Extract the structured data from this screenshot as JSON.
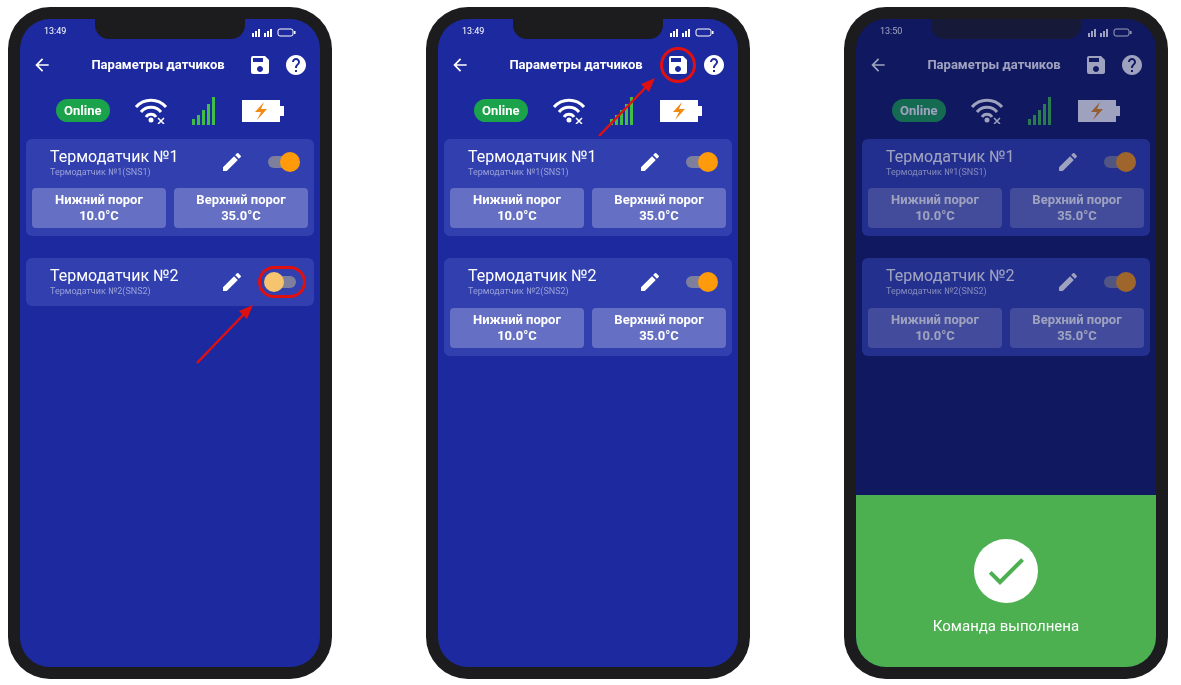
{
  "phones": [
    {
      "time": "13:49",
      "title": "Параметры датчиков",
      "status": "Online",
      "save_highlighted": false,
      "dimmed": false,
      "sensors": [
        {
          "name": "Термодатчик №1",
          "subtitle": "Термодатчик №1(SNS1)",
          "on": true,
          "highlighted": false,
          "thresholds": [
            {
              "label": "Нижний порог",
              "value": "10.0°C"
            },
            {
              "label": "Верхний порог",
              "value": "35.0°C"
            }
          ]
        },
        {
          "name": "Термодатчик №2",
          "subtitle": "Термодатчик №2(SNS2)",
          "on": false,
          "highlighted": true
        }
      ]
    },
    {
      "time": "13:49",
      "title": "Параметры датчиков",
      "status": "Online",
      "save_highlighted": true,
      "dimmed": false,
      "sensors": [
        {
          "name": "Термодатчик №1",
          "subtitle": "Термодатчик №1(SNS1)",
          "on": true,
          "highlighted": false,
          "thresholds": [
            {
              "label": "Нижний порог",
              "value": "10.0°C"
            },
            {
              "label": "Верхний порог",
              "value": "35.0°C"
            }
          ]
        },
        {
          "name": "Термодатчик №2",
          "subtitle": "Термодатчик №2(SNS2)",
          "on": true,
          "highlighted": false,
          "thresholds": [
            {
              "label": "Нижний порог",
              "value": "10.0°C"
            },
            {
              "label": "Верхний порог",
              "value": "35.0°C"
            }
          ]
        }
      ]
    },
    {
      "time": "13:50",
      "title": "Параметры датчиков",
      "status": "Online",
      "save_highlighted": false,
      "dimmed": true,
      "toast": "Команда выполнена",
      "sensors": [
        {
          "name": "Термодатчик №1",
          "subtitle": "Термодатчик №1(SNS1)",
          "on": true,
          "highlighted": false,
          "thresholds": [
            {
              "label": "Нижний порог",
              "value": "10.0°C"
            },
            {
              "label": "Верхний порог",
              "value": "35.0°C"
            }
          ]
        },
        {
          "name": "Термодатчик №2",
          "subtitle": "Термодатчик №2(SNS2)",
          "on": true,
          "highlighted": false,
          "thresholds": [
            {
              "label": "Нижний порог",
              "value": "10.0°C"
            },
            {
              "label": "Верхний порог",
              "value": "35.0°C"
            }
          ]
        }
      ]
    }
  ]
}
